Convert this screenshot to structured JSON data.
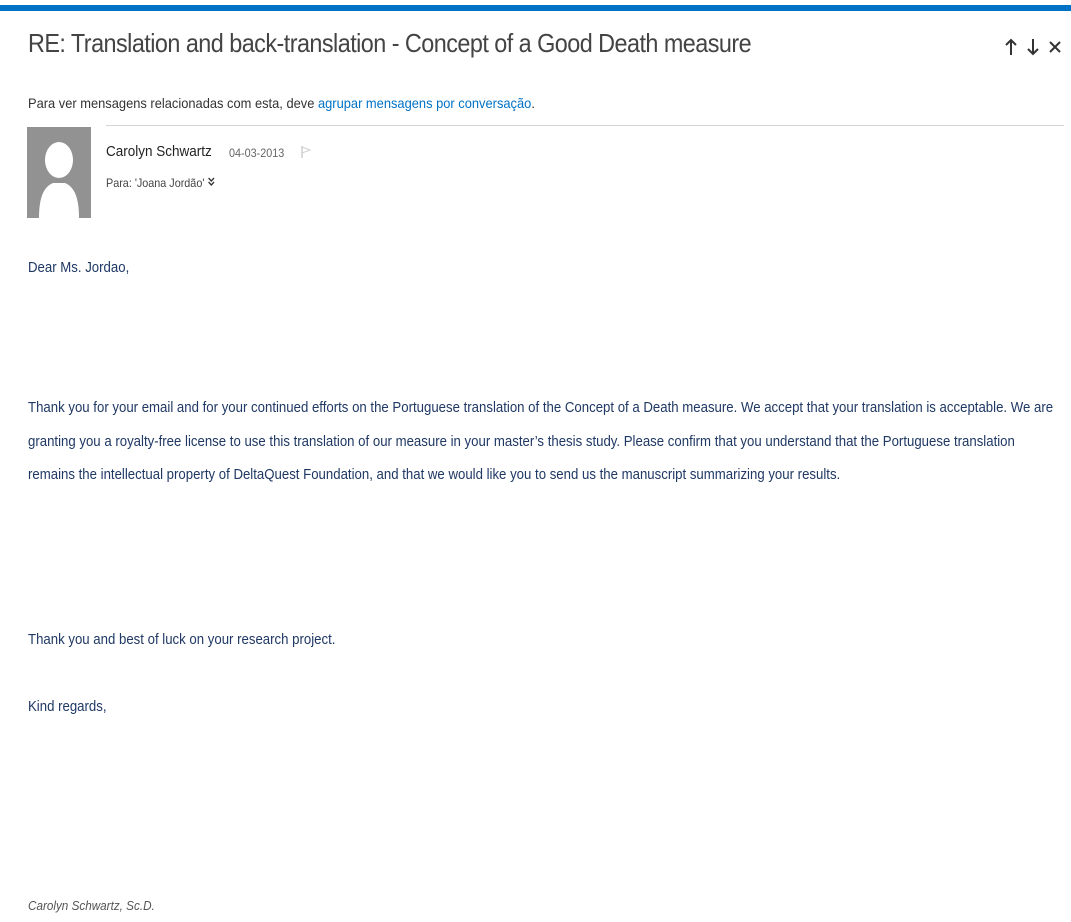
{
  "email": {
    "subject": "RE: Translation and back-translation - Concept of a Good Death measure",
    "nav": {
      "previous_icon": "arrow-up-icon",
      "next_icon": "arrow-down-icon",
      "close_icon": "close-icon"
    },
    "conversation_notice": {
      "prefix": "Para ver mensagens relacionadas com esta, deve ",
      "link": "agrupar mensagens por conversação",
      "suffix": "."
    },
    "sender": {
      "name": "Carolyn Schwartz",
      "date": "04-03-2013",
      "to": "Para: 'Joana Jordão'"
    },
    "body": {
      "greeting": "Dear Ms. Jordao,",
      "paragraph": "Thank you for your email and for your continued efforts on the Portuguese translation of the Concept of a Death measure. We accept that your translation is acceptable. We are granting you a royalty-free license to use this translation of our measure in your master’s thesis study. Please confirm that you understand that the Portuguese translation remains the intellectual property of DeltaQuest Foundation, and that we would like you to send us the manuscript summarizing your results.",
      "closing_thanks": "Thank you and best of luck on your research project.",
      "kind_regards": "Kind regards,",
      "signature": "Carolyn Schwartz, Sc.D."
    }
  },
  "colors": {
    "accent": "#0072c6",
    "body_text": "#1f3864",
    "avatar_bg": "#929292"
  }
}
